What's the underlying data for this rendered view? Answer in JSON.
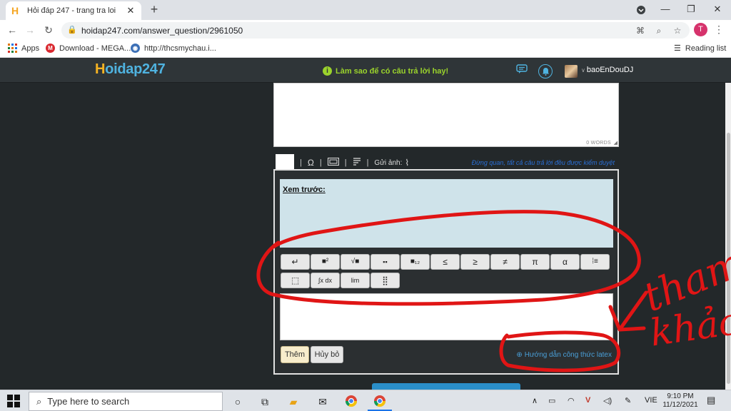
{
  "browser": {
    "tab_title": "Hỏi đáp 247 - trang tra loi",
    "tab_close": "✕",
    "new_tab": "+",
    "url": "hoidap247.com/answer_question/2961050",
    "profile_initial": "T",
    "bookmarks": [
      {
        "label": "Apps",
        "icon": "apps-grid-icon"
      },
      {
        "label": "Download - MEGA...",
        "icon": "mega-icon"
      },
      {
        "label": "http://thcsmychau.i...",
        "icon": "globe-icon"
      }
    ],
    "reading_list": "Reading list"
  },
  "site": {
    "logo_h": "H",
    "logo_rest": "oidap247",
    "tip_text": "Làm sao để có câu trả lời hay!",
    "username": "baoEnDouDJ",
    "accent_color": "#4fb3e0",
    "tip_color": "#9bd32c"
  },
  "editor": {
    "word_count": "0 WORDS",
    "upload_label": "Gửi ảnh:",
    "notice": "Đừng quan, tất cả câu trả lời đều được kiểm duyệt",
    "preview_label": "Xem trước:",
    "math_buttons_row1": [
      "↵",
      "■²",
      "√■",
      "▪▪",
      "■₁₂",
      "≤",
      "≥",
      "≠",
      "π",
      "α",
      "⁞≡"
    ],
    "math_buttons_row2": [
      "⬚",
      "∫x dx",
      "lim",
      "⣿"
    ],
    "submit_label": "Thêm",
    "cancel_label": "Hủy bỏ",
    "latex_link": "Hướng dẫn công thức latex"
  },
  "annotation": {
    "handwritten_line1": "tham",
    "handwritten_line2": "khảo"
  },
  "taskbar": {
    "search_placeholder": "Type here to search",
    "language": "VIE",
    "time": "9:10 PM",
    "date": "11/12/2021"
  }
}
